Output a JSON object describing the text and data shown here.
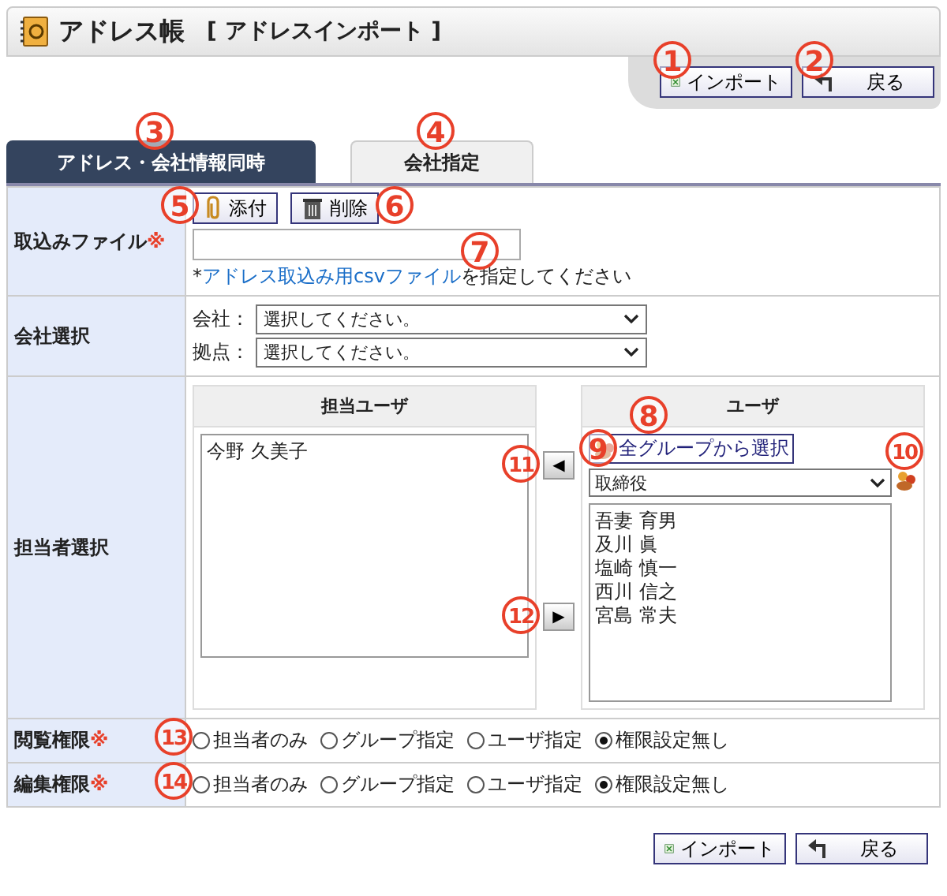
{
  "header": {
    "title": "アドレス帳",
    "subtitle": "[ アドレスインポート ]"
  },
  "top_buttons": [
    {
      "label": "インポート",
      "kind": "import",
      "callout": "1"
    },
    {
      "label": "戻る",
      "kind": "back",
      "callout": "2"
    }
  ],
  "tabs": [
    {
      "label": "アドレス・会社情報同時",
      "selected": true,
      "callout": "3"
    },
    {
      "label": "会社指定",
      "selected": false,
      "callout": "4"
    }
  ],
  "file_row": {
    "label": "取込みファイル",
    "required_mark": "※",
    "buttons": [
      {
        "label": "添付",
        "kind": "attach",
        "callout": "5"
      },
      {
        "label": "削除",
        "kind": "delete",
        "callout": "6"
      }
    ],
    "note_prefix": "*",
    "note_link": "アドレス取込み用csvファイル",
    "note_suffix": "を指定してください",
    "note_callout": "7"
  },
  "company_row": {
    "label": "会社選択",
    "fields": [
      {
        "label": "会社：",
        "value": "選択してください。"
      },
      {
        "label": "拠点：",
        "value": "選択してください。"
      }
    ]
  },
  "person_row": {
    "label": "担当者選択",
    "assigned": {
      "header": "担当ユーザ",
      "items": [
        "今野 久美子"
      ]
    },
    "move_buttons": [
      {
        "label": "◀",
        "callout": "11"
      },
      {
        "label": "▶",
        "callout": "12"
      }
    ],
    "users": {
      "header": "ユーザ",
      "group_button": "全グループから選択",
      "group_button_callout": "8",
      "group_value": "取締役",
      "group_select_callout": "9",
      "group_icon_callout": "10",
      "items": [
        "吾妻 育男",
        "及川 眞",
        "塩崎 慎一",
        "西川 信之",
        "宮島 常夫"
      ]
    }
  },
  "permissions": [
    {
      "label": "閲覧権限",
      "required_mark": "※",
      "callout": "13",
      "options": [
        {
          "label": "担当者のみ",
          "selected": false
        },
        {
          "label": "グループ指定",
          "selected": false
        },
        {
          "label": "ユーザ指定",
          "selected": false
        },
        {
          "label": "権限設定無し",
          "selected": true
        }
      ]
    },
    {
      "label": "編集権限",
      "required_mark": "※",
      "callout": "14",
      "options": [
        {
          "label": "担当者のみ",
          "selected": false
        },
        {
          "label": "グループ指定",
          "selected": false
        },
        {
          "label": "ユーザ指定",
          "selected": false
        },
        {
          "label": "権限設定無し",
          "selected": true
        }
      ]
    }
  ],
  "bottom_buttons": [
    {
      "label": "インポート",
      "kind": "import"
    },
    {
      "label": "戻る",
      "kind": "back"
    }
  ]
}
